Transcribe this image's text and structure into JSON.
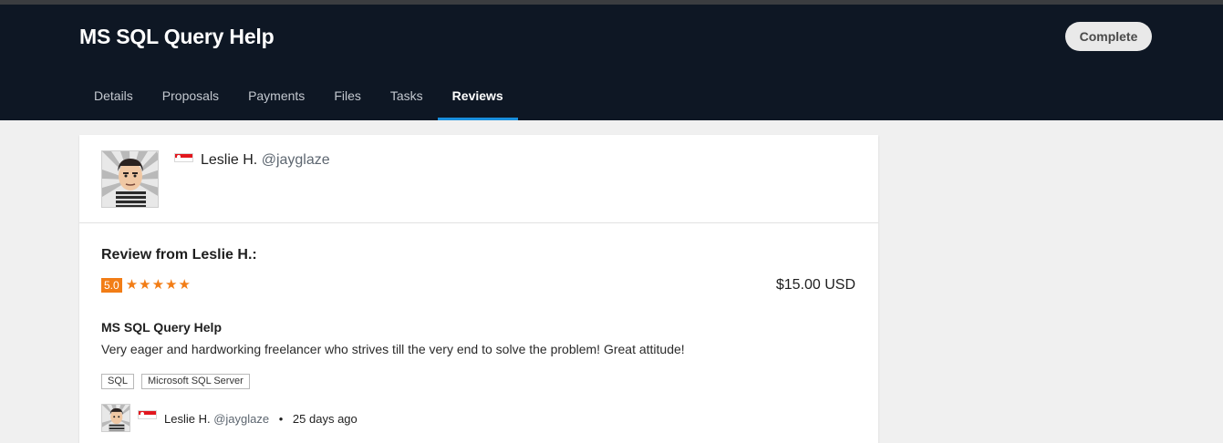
{
  "project": {
    "title": "MS SQL Query Help",
    "status_button": "Complete"
  },
  "tabs": [
    {
      "label": "Details"
    },
    {
      "label": "Proposals"
    },
    {
      "label": "Payments"
    },
    {
      "label": "Files"
    },
    {
      "label": "Tasks"
    },
    {
      "label": "Reviews",
      "active": true
    }
  ],
  "reviewer": {
    "name": "Leslie H.",
    "handle": "@jayglaze",
    "flag": "singapore-flag"
  },
  "review": {
    "heading": "Review from Leslie H.:",
    "rating": "5.0",
    "stars": "★★★★★",
    "amount": "$15.00 USD",
    "project_title": "MS SQL Query Help",
    "text": "Very eager and hardworking freelancer who strives till the very end to solve the problem! Great attitude!",
    "tags": [
      "SQL",
      "Microsoft SQL Server"
    ],
    "footer": {
      "name": "Leslie H.",
      "handle": "@jayglaze",
      "separator": "•",
      "time": "25 days ago"
    }
  },
  "colors": {
    "header_bg": "#0e1724",
    "accent": "#1a8fdd",
    "rating": "#f27d16"
  }
}
